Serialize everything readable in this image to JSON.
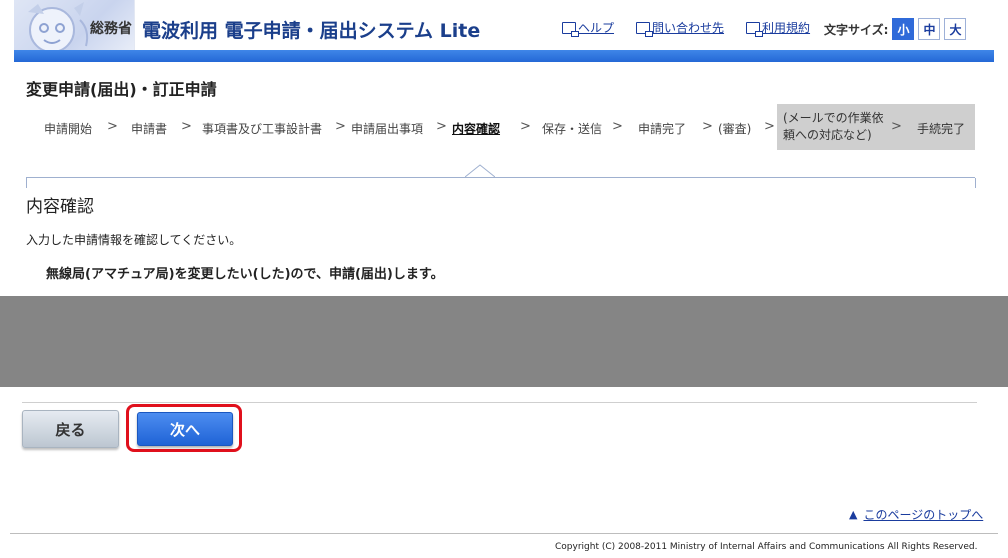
{
  "header": {
    "ministry": "総務省",
    "site_title": "電波利用 電子申請・届出システム Lite",
    "links": [
      {
        "label": "ヘルプ"
      },
      {
        "label": "問い合わせ先"
      },
      {
        "label": "利用規約"
      }
    ],
    "font_size_label": "文字サイズ:",
    "font_sizes": [
      "小",
      "中",
      "大"
    ],
    "selected_font_size": "小"
  },
  "page_title": "変更申請(届出)・訂正申請",
  "steps": [
    {
      "label": "申請開始"
    },
    {
      "label": "申請書"
    },
    {
      "label": "事項書及び工事設計書"
    },
    {
      "label": "申請届出事項"
    },
    {
      "label": "内容確認",
      "current": true
    },
    {
      "label": "保存・送信"
    },
    {
      "label": "申請完了"
    },
    {
      "label": "(審査)"
    },
    {
      "label": "(メールでの作業依頼への対応など)"
    },
    {
      "label": "手続完了"
    }
  ],
  "step_separator": ">",
  "content": {
    "section_title": "内容確認",
    "instruction": "入力した申請情報を確認してください。",
    "summary": "無線局(アマチュア局)を変更したい(した)ので、申請(届出)します。"
  },
  "buttons": {
    "back": "戻る",
    "next": "次へ"
  },
  "to_top": {
    "icon": "▲",
    "label": "このページのトップへ"
  },
  "copyright": "Copyright (C) 2008-2011 Ministry of Internal Affairs and Communications All Rights Reserved.",
  "colors": {
    "accent_blue": "#2468d6",
    "highlight_red": "#e0101c",
    "link_blue": "#1a3c9e"
  }
}
